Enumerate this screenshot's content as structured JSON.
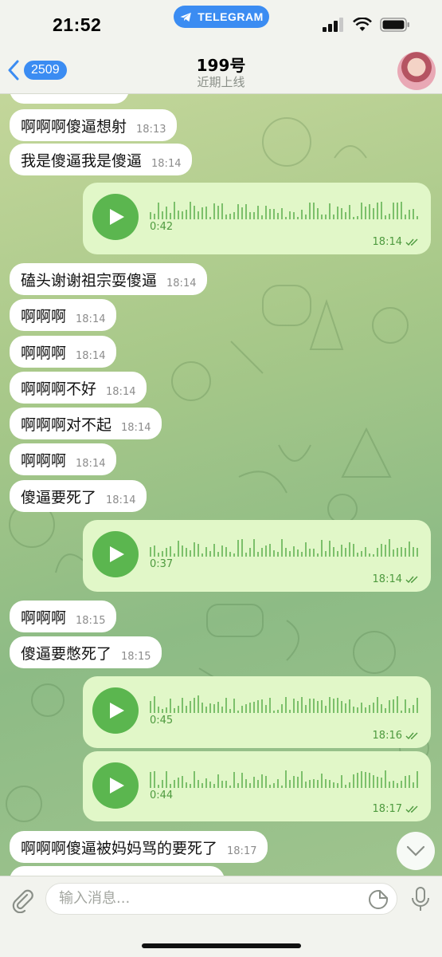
{
  "status": {
    "time": "21:52",
    "app_pill": "TELEGRAM"
  },
  "header": {
    "back_count": "2509",
    "title": "199号",
    "subtitle": "近期上线"
  },
  "messages": [
    {
      "type": "text",
      "text": "啊啊啊傻逼想射",
      "time": "18:13"
    },
    {
      "type": "text",
      "text": "我是傻逼我是傻逼",
      "time": "18:14"
    },
    {
      "type": "voice",
      "duration": "0:42",
      "time": "18:14"
    },
    {
      "type": "text",
      "text": "磕头谢谢祖宗耍傻逼",
      "time": "18:14"
    },
    {
      "type": "text",
      "text": "啊啊啊",
      "time": "18:14"
    },
    {
      "type": "text",
      "text": "啊啊啊",
      "time": "18:14"
    },
    {
      "type": "text",
      "text": "啊啊啊不好",
      "time": "18:14"
    },
    {
      "type": "text",
      "text": "啊啊啊对不起",
      "time": "18:14"
    },
    {
      "type": "text",
      "text": "啊啊啊",
      "time": "18:14"
    },
    {
      "type": "text",
      "text": "傻逼要死了",
      "time": "18:14"
    },
    {
      "type": "voice",
      "duration": "0:37",
      "time": "18:14"
    },
    {
      "type": "text",
      "text": "啊啊啊",
      "time": "18:15"
    },
    {
      "type": "text",
      "text": "傻逼要憋死了",
      "time": "18:15"
    },
    {
      "type": "voice",
      "duration": "0:45",
      "time": "18:16"
    },
    {
      "type": "voice",
      "duration": "0:44",
      "time": "18:17"
    },
    {
      "type": "text",
      "text": "啊啊啊傻逼被妈妈骂的要死了",
      "time": "18:17"
    }
  ],
  "input": {
    "placeholder": "输入消息..."
  },
  "icons": {
    "back": "chevron-left-icon",
    "play": "play-icon",
    "read": "double-check-icon",
    "attach": "paperclip-icon",
    "sticker": "sticker-icon",
    "mic": "microphone-icon",
    "scroll": "chevron-down-icon"
  },
  "colors": {
    "accent": "#3b8cf2",
    "voice_bubble": "#e1f7c8",
    "play": "#5bb64f",
    "outgoing_meta": "#4e9a3f"
  }
}
